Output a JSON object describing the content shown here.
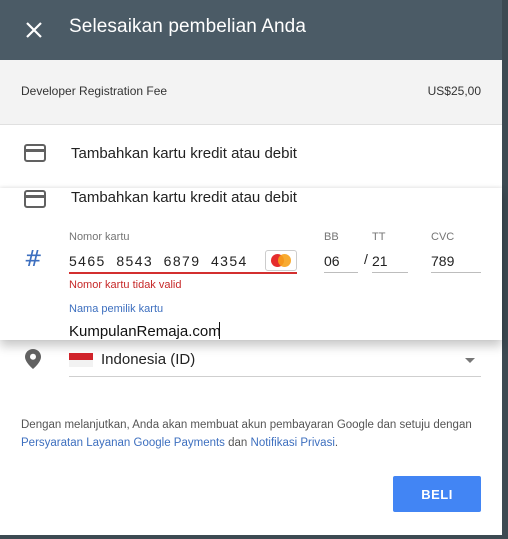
{
  "dialog": {
    "title": "Selesaikan pembelian Anda"
  },
  "fee": {
    "label": "Developer Registration Fee",
    "amount": "US$25,00"
  },
  "payment": {
    "add_card_label": "Tambahkan kartu kredit atau debit"
  },
  "card_form": {
    "title": "Tambahkan kartu kredit atau debit",
    "card_number_label": "Nomor kartu",
    "card_number_value": "5465  8543  6879  4354",
    "card_error": "Nomor kartu tidak valid",
    "card_brand_icon": "mastercard-icon",
    "month_label": "BB",
    "month_value": "06",
    "year_label": "TT",
    "year_value": "21",
    "cvc_label": "CVC",
    "cvc_value": "789",
    "name_label": "Nama pemilik kartu",
    "name_value": "KumpulanRemaja.com"
  },
  "country": {
    "value": "Indonesia (ID)"
  },
  "legal": {
    "text_before": "Dengan melanjutkan, Anda akan membuat akun pembayaran Google dan setuju dengan ",
    "terms_link": "Persyaratan Layanan Google Payments",
    "and_text": " dan ",
    "privacy_link": "Notifikasi Privasi",
    "end_text": "."
  },
  "actions": {
    "buy_label": "BELI"
  },
  "colors": {
    "header": "#4b5b66",
    "accent": "#4285f4",
    "error": "#d32f2f",
    "link": "#3d6fbf"
  }
}
